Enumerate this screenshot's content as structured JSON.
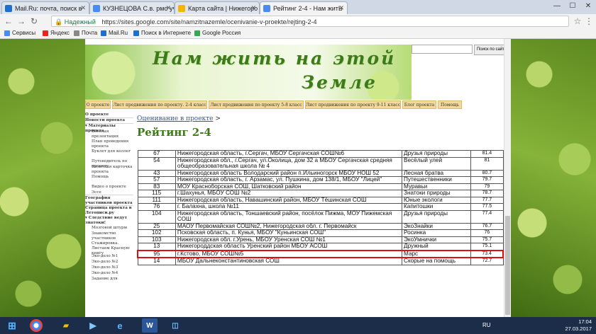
{
  "browser": {
    "tabs": [
      {
        "label": "Mail.Ru: почта, поиск в",
        "color": "#1e6fd0"
      },
      {
        "label": "КУЗНЕЦОВА С.в. рмо уч",
        "color": "#4a8af4"
      },
      {
        "label": "Карта сайта | Нижегоро",
        "color": "#f2b600"
      },
      {
        "label": "Рейтинг 2-4 - Нам житЬ",
        "color": "#4a8af4"
      }
    ],
    "secure_label": "Надежный",
    "url": "https://sites.google.com/site/namzitnazemle/ocenivanie-v-proekte/rejting-2-4",
    "bookmarks": [
      {
        "label": "Сервисы",
        "color": "#4a8af4"
      },
      {
        "label": "Яндекс",
        "color": "#e22"
      },
      {
        "label": "Почта",
        "color": "#888"
      },
      {
        "label": "Mail.Ru",
        "color": "#1e6fd0"
      },
      {
        "label": "Поиск в Интернете",
        "color": "#1e6fd0"
      },
      {
        "label": "Google Россия",
        "color": "#34a853"
      }
    ]
  },
  "site": {
    "search_button": "Поиск по сайту",
    "banner_line1": "Нам жить на этой",
    "banner_line2": "Земле",
    "nav": [
      "О проекте",
      "Лист продвижения по проекту. 2-4 класс",
      "Лист продвижения по проекту 5-8 класс",
      "Лист продвижения по проекту 9-11 класс",
      "Блог проекта",
      "Помощь"
    ],
    "sidebar": [
      {
        "label": "О проекте",
        "bold": true
      },
      {
        "label": "Новости проекта",
        "bold": true
      },
      {
        "label": "▾ Материалы проекта",
        "bold": true
      },
      {
        "label": "Веселая презентация",
        "bold": false
      },
      {
        "label": "План проведения проекта",
        "bold": false
      },
      {
        "label": "Буклет для коллег",
        "bold": false
      },
      {
        "label": "Путеводитель по проекту",
        "bold": false
      },
      {
        "label": "Визитная карточка проекта",
        "bold": false
      },
      {
        "label": "Помощь",
        "bold": false
      },
      {
        "label": "Видео о проекте",
        "bold": false
      },
      {
        "label": "Эссе",
        "bold": false
      },
      {
        "label": "География участников проекта",
        "bold": true
      },
      {
        "label": "Страница проекта в Летописи.ру",
        "bold": true
      },
      {
        "label": "▾ Следствие ведут знатоки!",
        "bold": true
      },
      {
        "label": "Мозговой штурм",
        "bold": false
      },
      {
        "label": "Знакомство участников",
        "bold": false
      },
      {
        "label": "Стажировка. Листаем Красную книгу",
        "bold": false
      },
      {
        "label": "Эко-дело №1",
        "bold": false
      },
      {
        "label": "Эко-дело №2",
        "bold": false
      },
      {
        "label": "Эко-дело №3",
        "bold": false
      },
      {
        "label": "Эко-дело №4",
        "bold": false
      },
      {
        "label": "Задание для",
        "bold": false
      }
    ],
    "breadcrumb_link": "Оценивание в проекте",
    "breadcrumb_sep": ">",
    "page_title": "Рейтинг 2-4"
  },
  "table": {
    "rows": [
      [
        "67",
        "Нижегородская область, г.Сергач, МБОУ Сергачская СОШ№6",
        "Друзья природы",
        "81.4"
      ],
      [
        "54",
        "Нижегородская обл., г.Сергач, ул.Околица, дом 32 а МБОУ Сергачская средняя общеобразовательная школа № 4",
        "Весёлый улей",
        "81"
      ],
      [
        "43",
        "Нижегородская область Володарский район п.Ильиногорск МБОУ НОШ 52",
        "Лесная братва",
        "80.7"
      ],
      [
        "57",
        "Нижегородская область, г. Арзамас, ул. Пушкина, дом 138/1, МБОУ \"Лицей\"",
        "Путешественники",
        "79.7"
      ],
      [
        "83",
        "МОУ Красноборская СОШ, Шатковский район",
        "Муравьи",
        "79"
      ],
      [
        "115",
        "г.Шахунья, МБОУ СОШ №2",
        "Знатоки природы",
        "78.7"
      ],
      [
        "111",
        "Нижегородская область, Навашинский район, МБОУ Тёшинская СОШ",
        "Юные экологи",
        "77.7"
      ],
      [
        "76",
        "г. Балахна, школа №11",
        "Капитошки",
        "77.5"
      ],
      [
        "104",
        "Нижегородская область, Тоншаевский район, посёлок Пижма, МОУ Пижемская СОШ",
        "Друзья природы",
        "77.4"
      ],
      [
        "25",
        "МАОУ Первомайская СОШ№2, Нижегородская обл. г. Первомайск",
        "ЭкоЗнайки",
        "76.7"
      ],
      [
        "102",
        "Псковская область, п. Кунья, МБОУ \"Куньинская СОШ\"",
        "Росинка",
        "76"
      ],
      [
        "103",
        "Нижегородская обл. г.Урень, МБОУ Уренская СОШ №1",
        "ЭкоУмнички",
        "75.7"
      ],
      [
        "13",
        "Нижегороддская область Уренский район МБОУ АСОШ",
        "Дружный",
        "75.1"
      ],
      [
        "95",
        "г.Кстово, МБОУ СОШ№5",
        "Марс",
        "73.4"
      ],
      [
        "14",
        "МБОУ Дальнеконстантиновская СОШ",
        "Скорые на помощь",
        "72.7"
      ]
    ]
  },
  "taskbar": {
    "lang": "RU",
    "time": "17:04",
    "date": "27.03.2017"
  }
}
